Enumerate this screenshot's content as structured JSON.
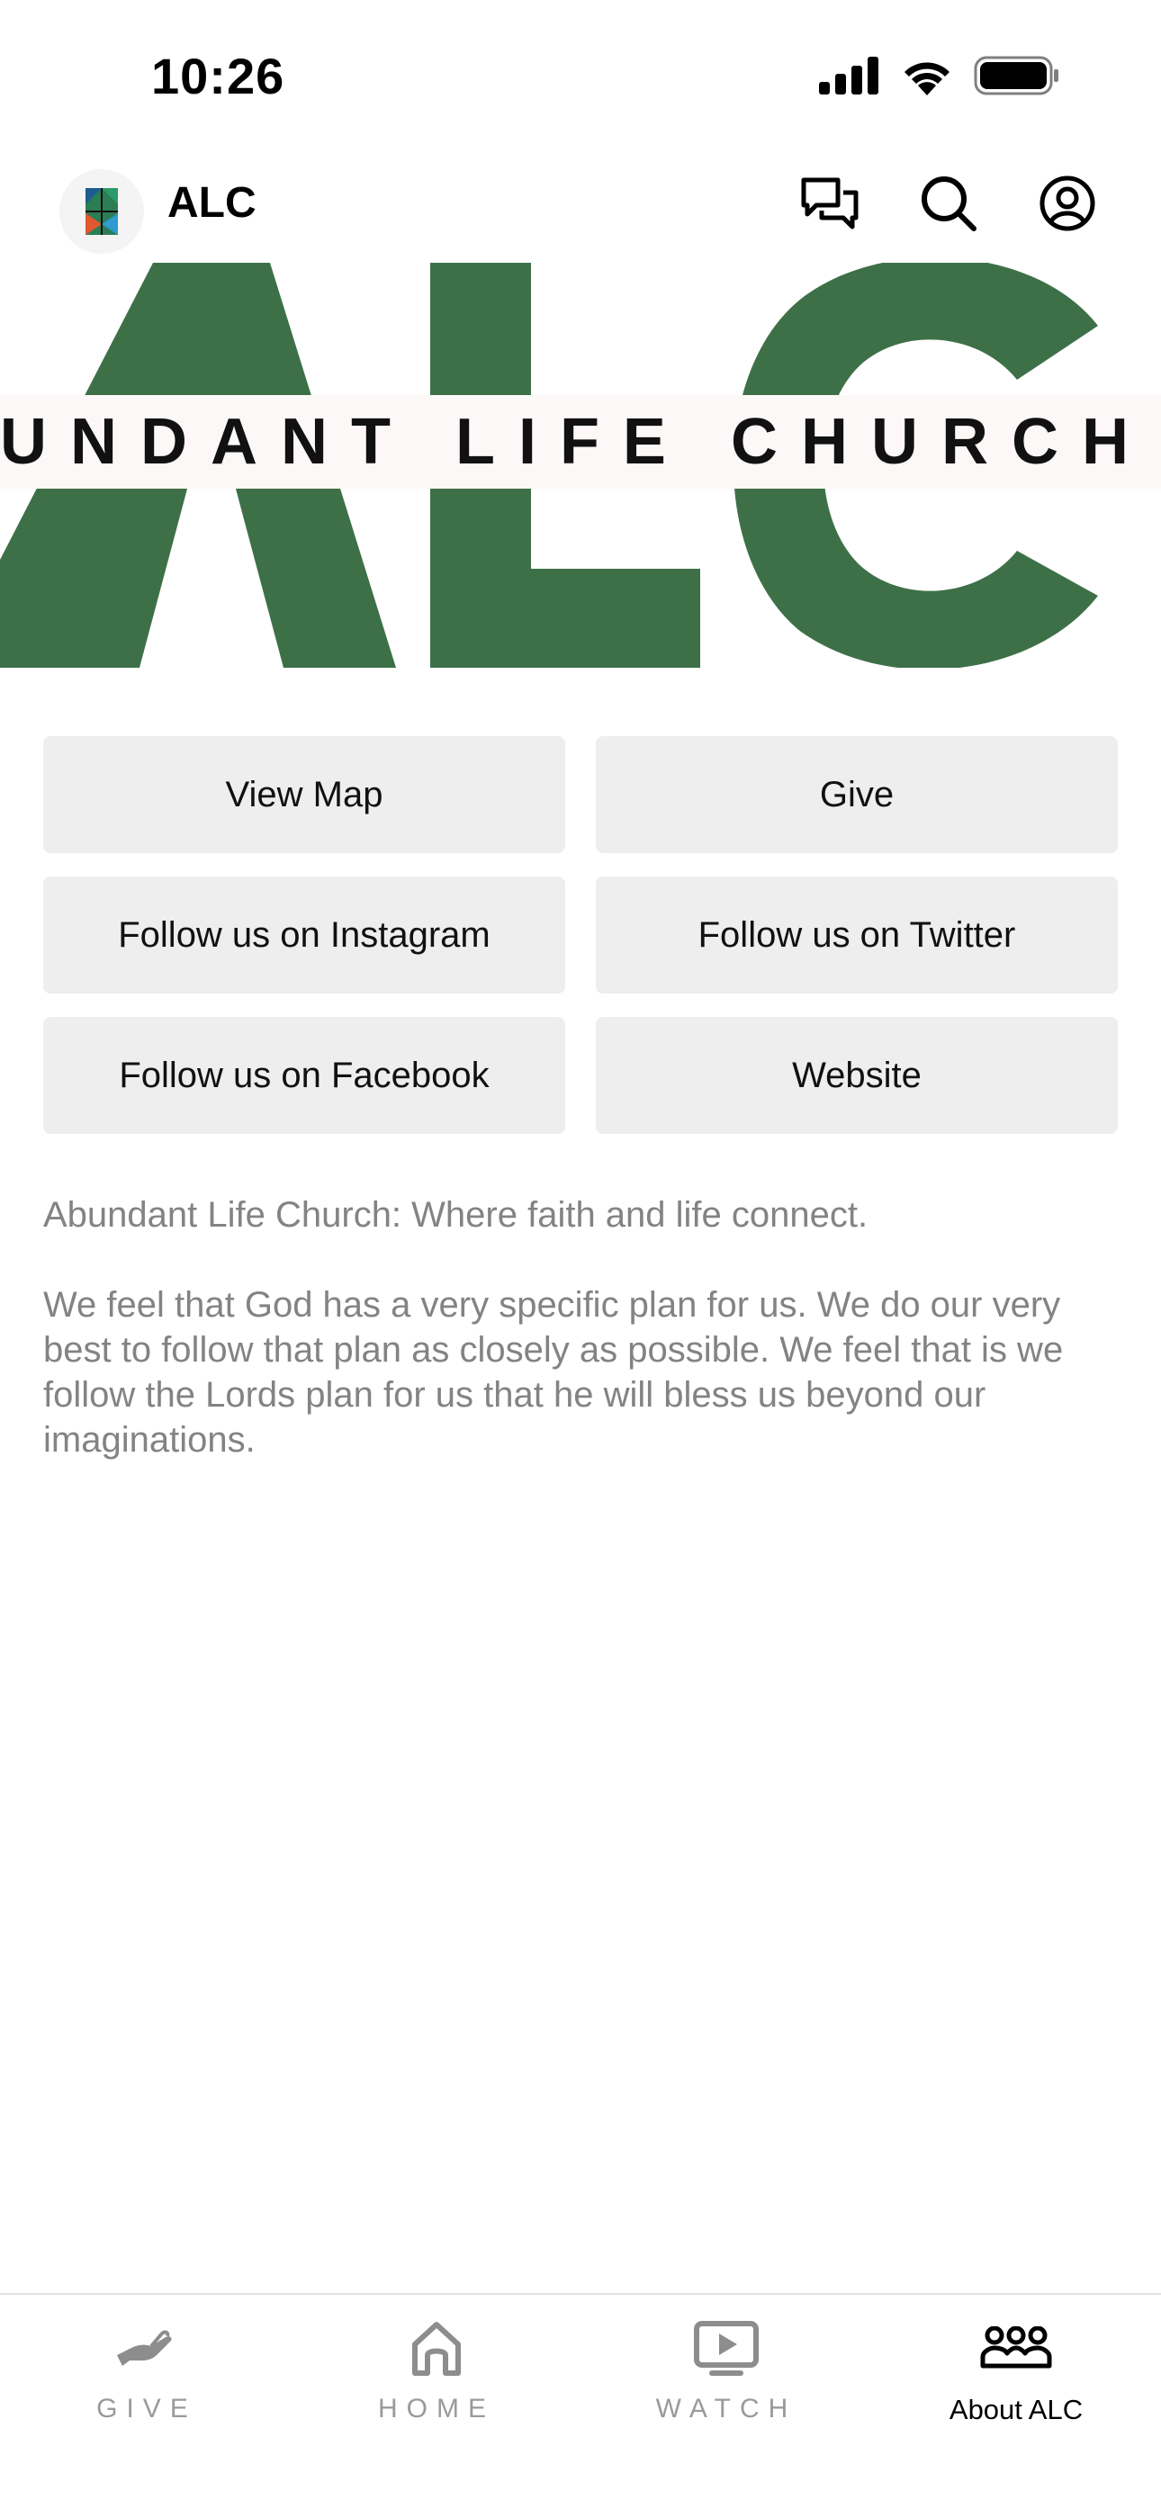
{
  "status_bar": {
    "time": "10:26",
    "icons": [
      "signal-icon",
      "wifi-icon",
      "battery-icon"
    ]
  },
  "header": {
    "title": "ALC",
    "actions": [
      "chat-icon",
      "search-icon",
      "profile-icon"
    ]
  },
  "banner": {
    "letters": "ALC",
    "tagline": "UNDANT LIFE CHURCH",
    "colors": {
      "green": "#3e7047"
    }
  },
  "actions": [
    {
      "label": "View Map"
    },
    {
      "label": "Give"
    },
    {
      "label": "Follow us on Instagram"
    },
    {
      "label": "Follow us on Twitter"
    },
    {
      "label": "Follow us on Facebook"
    },
    {
      "label": "Website"
    }
  ],
  "description": {
    "paragraph1": "Abundant Life Church: Where faith and life connect.",
    "paragraph2": "We feel that God has a very specific plan for us. We do our very best to follow that plan as closely as possible. We feel that is we follow the Lords plan for us that he will bless us beyond our imaginations."
  },
  "tabs": [
    {
      "label": "GIVE",
      "icon": "hand-icon",
      "active": false
    },
    {
      "label": "HOME",
      "icon": "home-icon",
      "active": false
    },
    {
      "label": "WATCH",
      "icon": "play-screen-icon",
      "active": false
    },
    {
      "label": "About ALC",
      "icon": "group-icon",
      "active": true
    }
  ]
}
